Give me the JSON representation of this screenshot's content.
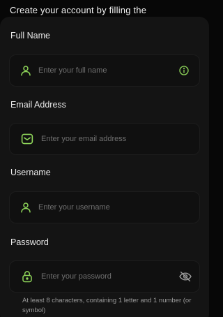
{
  "intro_text": "Create your account by filling the",
  "colors": {
    "accent": "#8fd65a",
    "background": "#070707",
    "card": "#141414"
  },
  "form": {
    "full_name": {
      "label": "Full Name",
      "placeholder": "Enter your full name",
      "icon": "user-icon",
      "trailing_icon": "info-icon"
    },
    "email": {
      "label": "Email Address",
      "placeholder": "Enter your email address",
      "icon": "mail-icon"
    },
    "username": {
      "label": "Username",
      "placeholder": "Enter your username",
      "icon": "user-icon"
    },
    "password": {
      "label": "Password",
      "placeholder": "Enter your password",
      "icon": "lock-icon",
      "trailing_icon": "eye-off-icon",
      "hint": "At least 8 characters, containing 1 letter and 1 number (or symbol)"
    }
  }
}
